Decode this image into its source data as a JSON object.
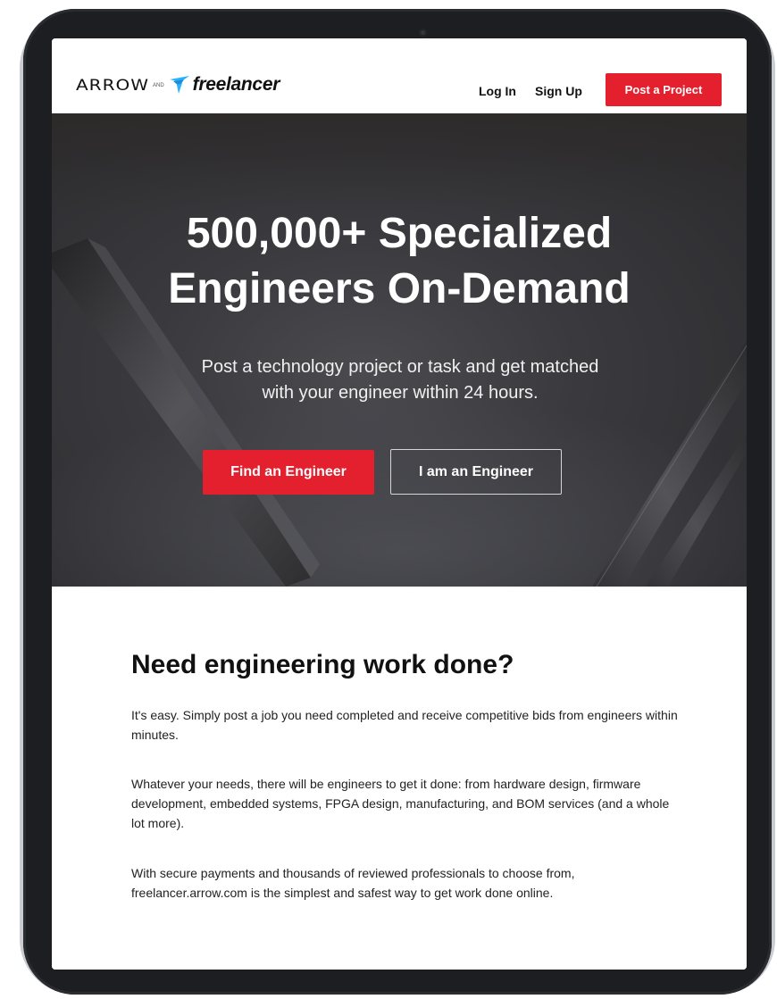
{
  "header": {
    "arrow_logo": "ARROW",
    "logo_and": "AND",
    "freelancer_logo": "freelancer",
    "login_label": "Log In",
    "signup_label": "Sign Up",
    "post_project_label": "Post a Project"
  },
  "hero": {
    "title_line1": "500,000+ Specialized",
    "title_line2": "Engineers On-Demand",
    "subtitle_line1": "Post a technology project or task and get matched",
    "subtitle_line2": "with your engineer within 24 hours.",
    "find_button": "Find an Engineer",
    "engineer_button": "I am an Engineer"
  },
  "content": {
    "title": "Need engineering work done?",
    "paragraph1": "It's easy. Simply post a job you need completed and receive competitive bids from engineers within minutes.",
    "paragraph2": "Whatever your needs, there will be engineers to get it done: from hardware design, firmware development, embedded systems, FPGA design, manufacturing, and BOM services (and a whole lot more).",
    "paragraph3": "With secure payments and thousands of reviewed professionals to choose from, freelancer.arrow.com is the simplest and safest way to get work done online."
  },
  "colors": {
    "accent_red": "#e5202e",
    "hero_bg": "#3a3a3e",
    "freelancer_blue": "#29b2fe"
  },
  "icons": {
    "logo_bird": "freelancer-bird-icon"
  }
}
